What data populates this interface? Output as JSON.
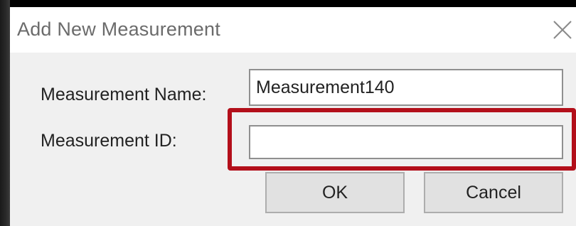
{
  "window": {
    "title": "Add New Measurement",
    "close_icon": "close-icon"
  },
  "form": {
    "name_label": "Measurement Name:",
    "name_value": "Measurement140",
    "id_label": "Measurement ID:",
    "id_value": ""
  },
  "buttons": {
    "ok_label": "OK",
    "cancel_label": "Cancel"
  },
  "colors": {
    "highlight": "#b30f1a",
    "dialog_background": "#f0f0f0",
    "titlebar_background": "#ffffff",
    "button_background": "#e1e1e1"
  }
}
